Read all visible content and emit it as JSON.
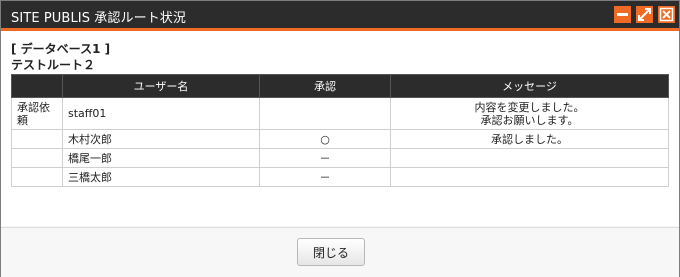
{
  "window": {
    "title": "SITE PUBLIS 承認ルート状況",
    "buttons": [
      {
        "icon": "minimize-icon"
      },
      {
        "icon": "maximize-icon"
      },
      {
        "icon": "close-icon"
      }
    ],
    "accent_color": "#ef6a22",
    "titlebar_color": "#2c2c2c"
  },
  "database_label": "[ データベース1 ]",
  "route_name": "テストルート２",
  "table": {
    "headers": [
      "",
      "ユーザー名",
      "承認",
      "メッセージ"
    ],
    "rows": [
      {
        "step": "承認依頼",
        "user": "staff01",
        "approval": "",
        "message_lines": [
          "内容を変更しました。",
          "承認お願いします。"
        ]
      },
      {
        "step": "",
        "user": "木村次郎",
        "approval": "○",
        "message_lines": [
          "承認しました。"
        ]
      },
      {
        "step": "",
        "user": "橋尾一郎",
        "approval": "－",
        "message_lines": []
      },
      {
        "step": "",
        "user": "三橋太郎",
        "approval": "－",
        "message_lines": []
      }
    ]
  },
  "footer": {
    "close_label": "閉じる"
  }
}
